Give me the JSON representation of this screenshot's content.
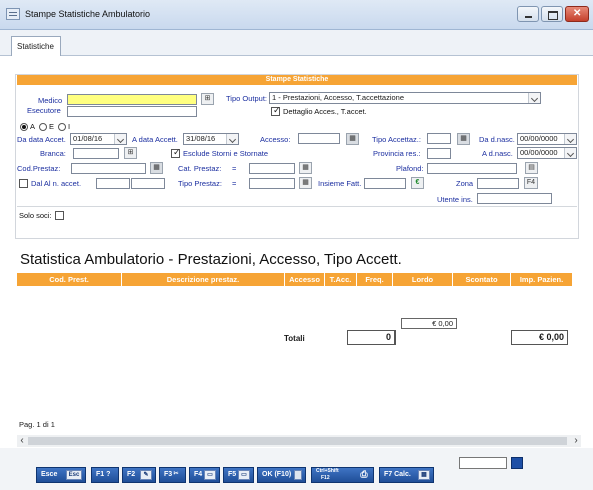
{
  "window": {
    "title": "Stampe Statistiche Ambulatorio"
  },
  "tabs": [
    "Statistiche"
  ],
  "form": {
    "header": "Stampe Statistiche",
    "medico_label": "Medico",
    "medico_value": "",
    "esecutore_label": "Esecutore",
    "esecutore_value": "",
    "tipo_output_label": "Tipo Output:",
    "tipo_output_value": "1 - Prestazioni, Accesso, T.accettazione",
    "dettaglio_label": "Dettaglio Acces., T.accet.",
    "dettaglio_checked": true,
    "radio_a_label": "A",
    "radio_e_label": "E",
    "radio_i_label": "I",
    "radio_selected": "A",
    "da_data_label": "Da data Accet.",
    "da_data_value": "01/08/16",
    "a_data_label": "A data Accett.",
    "a_data_value": "31/08/16",
    "accesso_label": "Accesso:",
    "accesso_value": "",
    "tipo_accettaz_label": "Tipo Accettaz.:",
    "tipo_accettaz_value": "",
    "da_dnasc_label": "Da d.nasc.",
    "da_dnasc_value": "00/00/0000",
    "branca_label": "Branca:",
    "branca_value": "",
    "esclude_label": "Esclude Storni e Stornate",
    "esclude_checked": true,
    "provincia_label": "Provincia res.:",
    "provincia_value": "",
    "a_dnasc_label": "A d.nasc.",
    "a_dnasc_value": "00/00/0000",
    "cod_prestaz_label": "Cod.Prestaz:",
    "cod_prestaz_value": "",
    "cat_prestaz_label": "Cat. Prestaz:",
    "cat_prestaz_op": "=",
    "cat_prestaz_value": "",
    "plafond_label": "Plafond:",
    "plafond_value": "",
    "dal_al_label": "Dal Al n. accet.",
    "dal_value": "",
    "al_value": "",
    "tipo_prestaz_label": "Tipo Prestaz:",
    "tipo_prestaz_op": "=",
    "tipo_prestaz_value": "",
    "insieme_label": "Insieme Fatt.",
    "insieme_value": "",
    "zona_label": "Zona",
    "zona_value": "",
    "f4_label": "F4",
    "utente_label": "Utente ins.",
    "utente_value": "",
    "solo_soci_label": "Solo soci:"
  },
  "report": {
    "title": "Statistica Ambulatorio - Prestazioni, Accesso, Tipo Accett.",
    "columns": [
      "Cod. Prest.",
      "Descrizione prestaz.",
      "Accesso",
      "T.Acc.",
      "Freq.",
      "Lordo",
      "Scontato",
      "Imp. Pazien."
    ],
    "lordo_sub": "€ 0,00",
    "totali_label": "Totali",
    "totali_freq": "0",
    "totali_imp": "€ 0,00",
    "page_info": "Pag. 1 di 1"
  },
  "buttons": {
    "esce": "Esce",
    "esce_key": "Esc",
    "f1": "F1 ?",
    "f2": "F2",
    "f3": "F3",
    "f4": "F4",
    "f5": "F5",
    "ok": "OK (F10)",
    "print_line1": "Ctrl+Shift",
    "print_line2": "F12",
    "f7": "F7 Calc."
  },
  "icons": {
    "search": "search-icon",
    "calendar": "calendar-icon",
    "grid": "grid-icon",
    "euro": "euro-icon"
  },
  "colors": {
    "accent_orange": "#f6a435",
    "label_blue": "#1c2fa0",
    "button_blue": "#1f4e98",
    "required_yellow": "#ffff80"
  }
}
